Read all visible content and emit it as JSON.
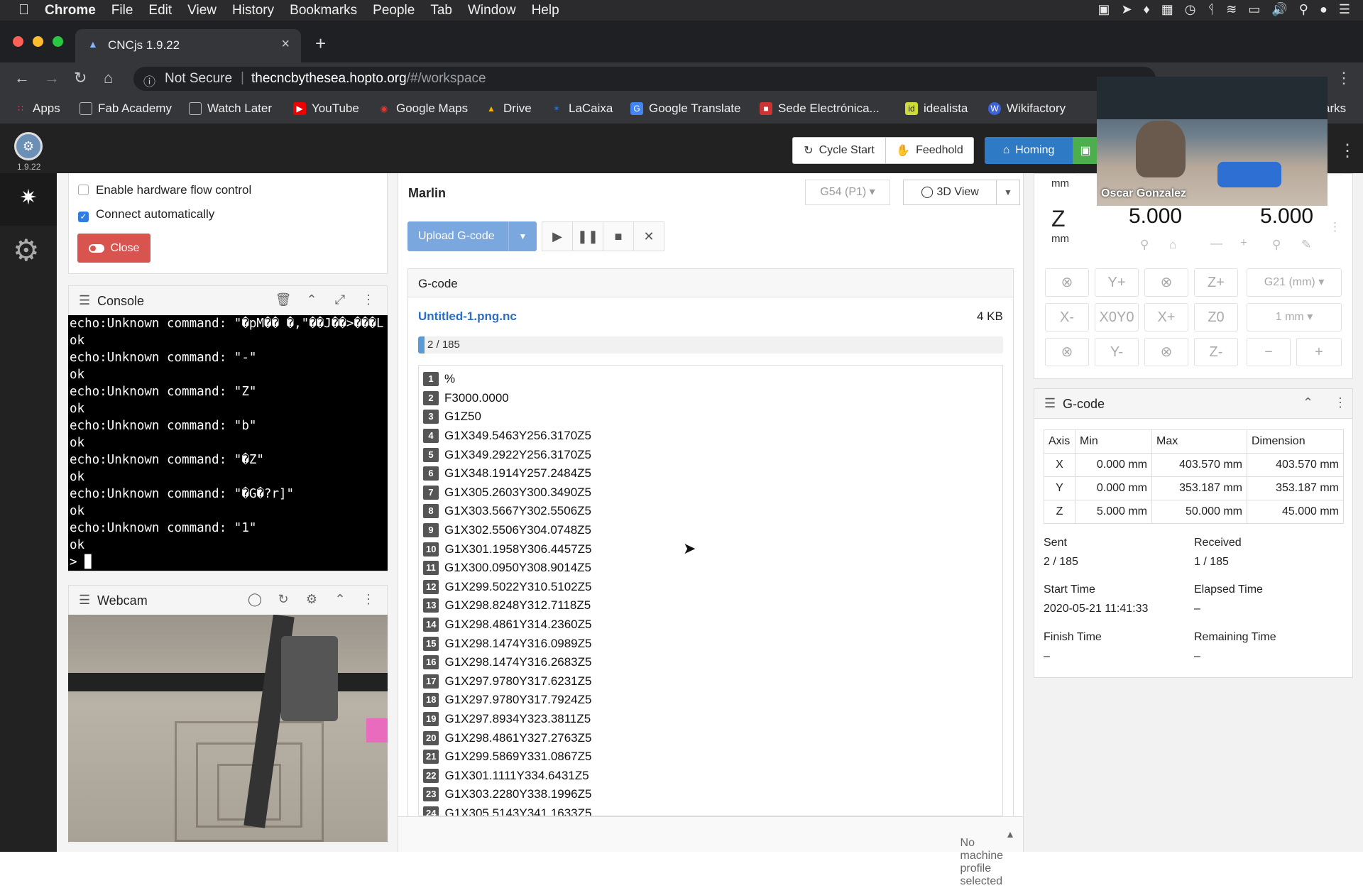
{
  "macos_menu": {
    "app": "Chrome",
    "items": [
      "File",
      "Edit",
      "View",
      "History",
      "Bookmarks",
      "People",
      "Tab",
      "Window",
      "Help"
    ]
  },
  "browser": {
    "tab_title": "CNCjs 1.9.22",
    "security_label": "Not Secure",
    "url_host": "thecncbythesea.hopto.org",
    "url_path": "/#/workspace",
    "bookmarks": [
      "Apps",
      "Fab Academy",
      "Watch Later",
      "YouTube",
      "Google Maps",
      "Drive",
      "LaCaixa",
      "Google Translate",
      "Sede Electrónica...",
      "idealista",
      "Wikifactory",
      "arks"
    ]
  },
  "app": {
    "version": "1.9.22",
    "cycle_start": "Cycle Start",
    "feedhold": "Feedhold",
    "homing": "Homing"
  },
  "connection": {
    "hw_flow_label": "Enable hardware flow control",
    "hw_flow_checked": false,
    "auto_connect_label": "Connect automatically",
    "auto_connect_checked": true,
    "close_button": "Close"
  },
  "console": {
    "title": "Console",
    "lines": [
      "echo:Unknown command: \"\u0000pM\u0000\u0000 \u0000,\"\u0000\u0000J\u0000\u0000>\u0000\u0000\u0000L",
      "ok",
      "echo:Unknown command: \"-\"",
      "ok",
      "echo:Unknown command: \"Z\"",
      "ok",
      "echo:Unknown command: \"b\"",
      "ok",
      "echo:Unknown command: \"\u0000Z\"",
      "ok",
      "echo:Unknown command: \"\u0000G\u0000?r]\"",
      "ok",
      "echo:Unknown command: \"1\"",
      "ok",
      "> ▉"
    ]
  },
  "webcam": {
    "title": "Webcam"
  },
  "workspace": {
    "controller": "Marlin",
    "wcs": "G54 (P1)",
    "view_button": "3D View",
    "upload_button": "Upload G-code",
    "gcode_panel_title": "G-code",
    "file_name": "Untitled-1.png.nc",
    "file_size": "4 KB",
    "progress_text": "2 / 185",
    "progress_fraction": 0.0108,
    "gcode_lines": [
      {
        "n": "1",
        "code": "%"
      },
      {
        "n": "2",
        "code": "F3000.0000"
      },
      {
        "n": "3",
        "code": "G1Z50"
      },
      {
        "n": "4",
        "code": "G1X349.5463Y256.3170Z5"
      },
      {
        "n": "5",
        "code": "G1X349.2922Y256.3170Z5"
      },
      {
        "n": "6",
        "code": "G1X348.1914Y257.2484Z5"
      },
      {
        "n": "7",
        "code": "G1X305.2603Y300.3490Z5"
      },
      {
        "n": "8",
        "code": "G1X303.5667Y302.5506Z5"
      },
      {
        "n": "9",
        "code": "G1X302.5506Y304.0748Z5"
      },
      {
        "n": "10",
        "code": "G1X301.1958Y306.4457Z5"
      },
      {
        "n": "11",
        "code": "G1X300.0950Y308.9014Z5"
      },
      {
        "n": "12",
        "code": "G1X299.5022Y310.5102Z5"
      },
      {
        "n": "13",
        "code": "G1X298.8248Y312.7118Z5"
      },
      {
        "n": "14",
        "code": "G1X298.4861Y314.2360Z5"
      },
      {
        "n": "15",
        "code": "G1X298.1474Y316.0989Z5"
      },
      {
        "n": "16",
        "code": "G1X298.1474Y316.2683Z5"
      },
      {
        "n": "17",
        "code": "G1X297.9780Y317.6231Z5"
      },
      {
        "n": "18",
        "code": "G1X297.9780Y317.7924Z5"
      },
      {
        "n": "19",
        "code": "G1X297.8934Y323.3811Z5"
      },
      {
        "n": "20",
        "code": "G1X298.4861Y327.2763Z5"
      },
      {
        "n": "21",
        "code": "G1X299.5869Y331.0867Z5"
      },
      {
        "n": "22",
        "code": "G1X301.1111Y334.6431Z5"
      },
      {
        "n": "23",
        "code": "G1X303.2280Y338.1996Z5"
      },
      {
        "n": "24",
        "code": "G1X305.5143Y341.1633Z5"
      }
    ],
    "footer": "No machine profile selected"
  },
  "axes": {
    "mm_top": "mm",
    "z_label": "Z",
    "z_unit": "mm",
    "z_machine": "5.000",
    "z_work": "5.000",
    "jog_rows": [
      [
        "⊗",
        "Y+",
        "⊗",
        "Z+",
        "G21 (mm)"
      ],
      [
        "X-",
        "X0Y0",
        "X+",
        "Z0",
        "1 mm"
      ],
      [
        "⊗",
        "Y-",
        "⊗",
        "Z-",
        "−",
        "+"
      ]
    ]
  },
  "gcode_widget": {
    "title": "G-code",
    "headers": [
      "Axis",
      "Min",
      "Max",
      "Dimension"
    ],
    "rows": [
      [
        "X",
        "0.000 mm",
        "403.570 mm",
        "403.570 mm"
      ],
      [
        "Y",
        "0.000 mm",
        "353.187 mm",
        "353.187 mm"
      ],
      [
        "Z",
        "5.000 mm",
        "50.000 mm",
        "45.000 mm"
      ]
    ],
    "sent_label": "Sent",
    "sent": "2 / 185",
    "received_label": "Received",
    "received": "1 / 185",
    "start_label": "Start Time",
    "start": "2020-05-21 11:41:33",
    "elapsed_label": "Elapsed Time",
    "elapsed": "–",
    "finish_label": "Finish Time",
    "finish": "–",
    "remaining_label": "Remaining Time",
    "remaining": "–"
  },
  "video_call": {
    "name": "Oscar Gonzalez"
  },
  "colors": {
    "accent": "#2f7de1",
    "danger": "#d9534f",
    "homing": "#2f7ac5",
    "upload": "#7ba7df"
  }
}
